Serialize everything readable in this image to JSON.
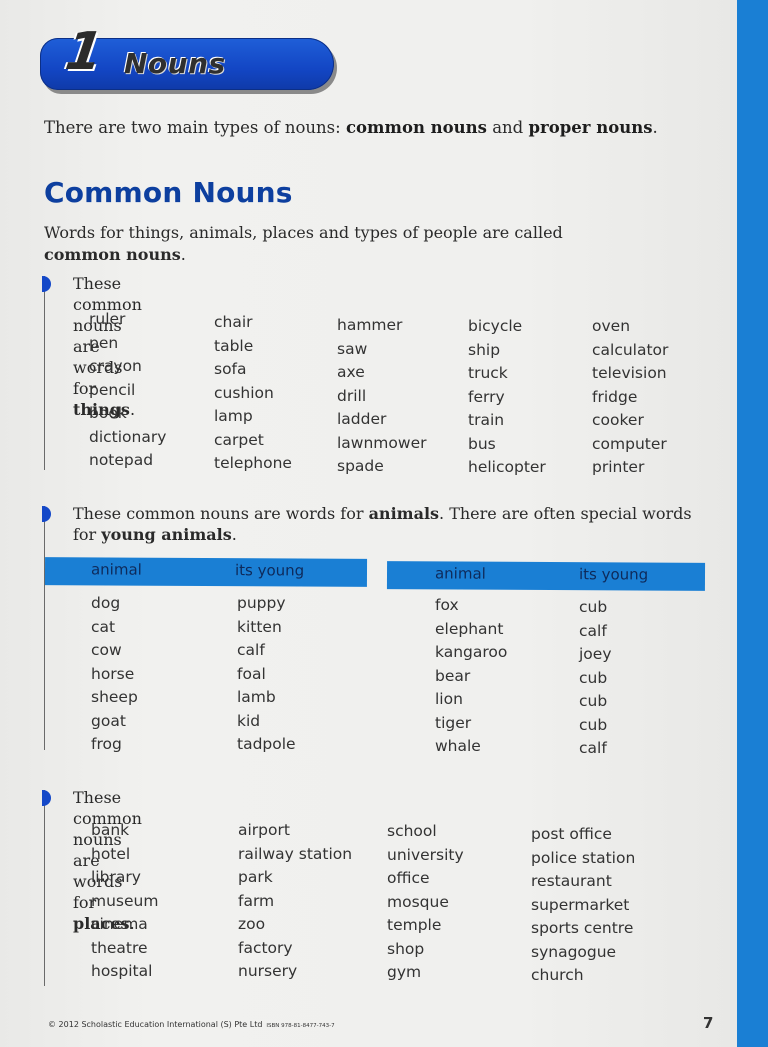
{
  "chapter": {
    "number": "1",
    "title": "Nouns"
  },
  "intro": {
    "text_before": "There are two main types of nouns: ",
    "bold_1": "common nouns",
    "text_mid": " and ",
    "bold_2": "proper nouns",
    "text_after": "."
  },
  "section": {
    "title": "Common Nouns",
    "desc_text": "Words for things, animals, places and types of people are called ",
    "desc_bold": "common nouns",
    "desc_end": "."
  },
  "things": {
    "head_text": "These common nouns are words for ",
    "head_bold": "things",
    "head_end": ".",
    "columns": [
      [
        "ruler",
        "pen",
        "crayon",
        "pencil",
        "book",
        "dictionary",
        "notepad"
      ],
      [
        "chair",
        "table",
        "sofa",
        "cushion",
        "lamp",
        "carpet",
        "telephone"
      ],
      [
        "hammer",
        "saw",
        "axe",
        "drill",
        "ladder",
        "lawnmower",
        "spade"
      ],
      [
        "bicycle",
        "ship",
        "truck",
        "ferry",
        "train",
        "bus",
        "helicopter"
      ],
      [
        "oven",
        "calculator",
        "television",
        "fridge",
        "cooker",
        "computer",
        "printer"
      ]
    ]
  },
  "animals": {
    "head_text_1": "These common nouns are words for ",
    "head_bold_1": "animals",
    "head_text_2": ". There are often special words for ",
    "head_bold_2": "young animals",
    "head_end": ".",
    "tables": [
      {
        "headers": [
          "animal",
          "its young"
        ],
        "rows": [
          [
            "dog",
            "puppy"
          ],
          [
            "cat",
            "kitten"
          ],
          [
            "cow",
            "calf"
          ],
          [
            "horse",
            "foal"
          ],
          [
            "sheep",
            "lamb"
          ],
          [
            "goat",
            "kid"
          ],
          [
            "frog",
            "tadpole"
          ]
        ]
      },
      {
        "headers": [
          "animal",
          "its young"
        ],
        "rows": [
          [
            "fox",
            "cub"
          ],
          [
            "elephant",
            "calf"
          ],
          [
            "kangaroo",
            "joey"
          ],
          [
            "bear",
            "cub"
          ],
          [
            "lion",
            "cub"
          ],
          [
            "tiger",
            "cub"
          ],
          [
            "whale",
            "calf"
          ]
        ]
      }
    ]
  },
  "places": {
    "head_text": "These common nouns are words for ",
    "head_bold": "places",
    "head_end": ".",
    "columns": [
      [
        "bank",
        "hotel",
        "library",
        "museum",
        "cinema",
        "theatre",
        "hospital"
      ],
      [
        "airport",
        "railway station",
        "park",
        "farm",
        "zoo",
        "factory",
        "nursery"
      ],
      [
        "school",
        "university",
        "office",
        "mosque",
        "temple",
        "shop",
        "gym"
      ],
      [
        "post office",
        "police station",
        "restaurant",
        "supermarket",
        "sports centre",
        "synagogue",
        "church"
      ]
    ]
  },
  "footer": {
    "copyright": "© 2012 Scholastic Education International (S) Pte Ltd",
    "isbn": "ISBN 978-81-8477-743-7",
    "page_number": "7"
  },
  "colors": {
    "banner_blue": "#1346c4",
    "heading_blue": "#0d3f9f",
    "table_header_blue": "#1a7fd4",
    "edge_blue": "#1a7fd4",
    "bullet_blue": "#1448c8"
  }
}
